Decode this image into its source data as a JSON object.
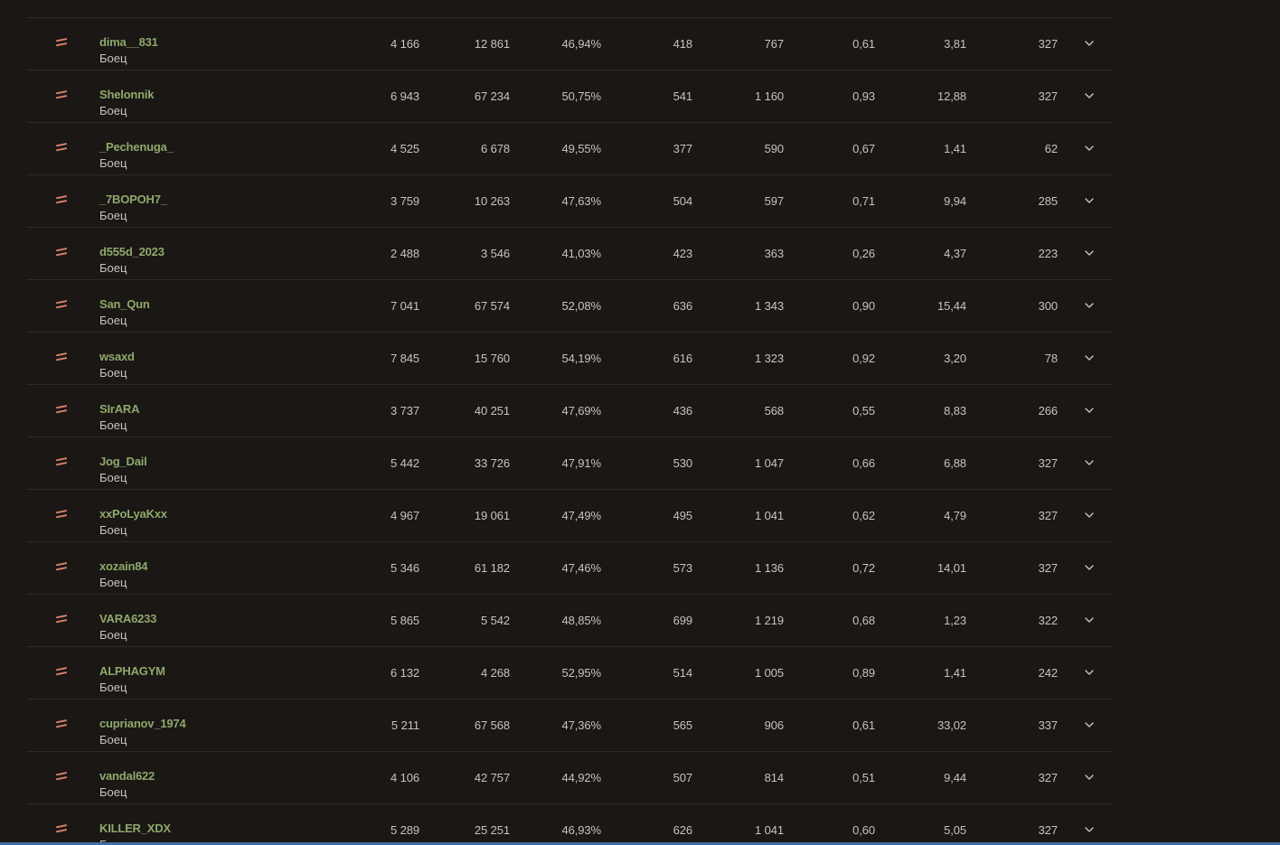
{
  "colors": {
    "background": "#1a1715",
    "name_green": "#8fa86b",
    "text": "#c9c3bd",
    "rank_icon": "#d9826a",
    "divider": "#2e2a27"
  },
  "icons": {
    "rank": "rank-equal-icon",
    "expand": "chevron-down-icon"
  },
  "rows": [
    {
      "name": "",
      "role": "Боец",
      "battles": "",
      "rating": "",
      "wins": "",
      "dmg": "",
      "exp": "",
      "kd": "",
      "spot": "",
      "days": ""
    },
    {
      "name": "dima__831",
      "role": "Боец",
      "battles": "4 166",
      "rating": "12 861",
      "wins": "46,94%",
      "dmg": "418",
      "exp": "767",
      "kd": "0,61",
      "spot": "3,81",
      "days": "327"
    },
    {
      "name": "Shelonnik",
      "role": "Боец",
      "battles": "6 943",
      "rating": "67 234",
      "wins": "50,75%",
      "dmg": "541",
      "exp": "1 160",
      "kd": "0,93",
      "spot": "12,88",
      "days": "327"
    },
    {
      "name": "_Pechenuga_",
      "role": "Боец",
      "battles": "4 525",
      "rating": "6 678",
      "wins": "49,55%",
      "dmg": "377",
      "exp": "590",
      "kd": "0,67",
      "spot": "1,41",
      "days": "62"
    },
    {
      "name": "_7BOPOH7_",
      "role": "Боец",
      "battles": "3 759",
      "rating": "10 263",
      "wins": "47,63%",
      "dmg": "504",
      "exp": "597",
      "kd": "0,71",
      "spot": "9,94",
      "days": "285"
    },
    {
      "name": "d555d_2023",
      "role": "Боец",
      "battles": "2 488",
      "rating": "3 546",
      "wins": "41,03%",
      "dmg": "423",
      "exp": "363",
      "kd": "0,26",
      "spot": "4,37",
      "days": "223"
    },
    {
      "name": "San_Qun",
      "role": "Боец",
      "battles": "7 041",
      "rating": "67 574",
      "wins": "52,08%",
      "dmg": "636",
      "exp": "1 343",
      "kd": "0,90",
      "spot": "15,44",
      "days": "300"
    },
    {
      "name": "wsaxd",
      "role": "Боец",
      "battles": "7 845",
      "rating": "15 760",
      "wins": "54,19%",
      "dmg": "616",
      "exp": "1 323",
      "kd": "0,92",
      "spot": "3,20",
      "days": "78"
    },
    {
      "name": "SIrARA",
      "role": "Боец",
      "battles": "3 737",
      "rating": "40 251",
      "wins": "47,69%",
      "dmg": "436",
      "exp": "568",
      "kd": "0,55",
      "spot": "8,83",
      "days": "266"
    },
    {
      "name": "Jog_Dail",
      "role": "Боец",
      "battles": "5 442",
      "rating": "33 726",
      "wins": "47,91%",
      "dmg": "530",
      "exp": "1 047",
      "kd": "0,66",
      "spot": "6,88",
      "days": "327"
    },
    {
      "name": "xxPoLyaKxx",
      "role": "Боец",
      "battles": "4 967",
      "rating": "19 061",
      "wins": "47,49%",
      "dmg": "495",
      "exp": "1 041",
      "kd": "0,62",
      "spot": "4,79",
      "days": "327"
    },
    {
      "name": "xozain84",
      "role": "Боец",
      "battles": "5 346",
      "rating": "61 182",
      "wins": "47,46%",
      "dmg": "573",
      "exp": "1 136",
      "kd": "0,72",
      "spot": "14,01",
      "days": "327"
    },
    {
      "name": "VARA6233",
      "role": "Боец",
      "battles": "5 865",
      "rating": "5 542",
      "wins": "48,85%",
      "dmg": "699",
      "exp": "1 219",
      "kd": "0,68",
      "spot": "1,23",
      "days": "322"
    },
    {
      "name": "ALPHAGYM",
      "role": "Боец",
      "battles": "6 132",
      "rating": "4 268",
      "wins": "52,95%",
      "dmg": "514",
      "exp": "1 005",
      "kd": "0,89",
      "spot": "1,41",
      "days": "242"
    },
    {
      "name": "cuprianov_1974",
      "role": "Боец",
      "battles": "5 211",
      "rating": "67 568",
      "wins": "47,36%",
      "dmg": "565",
      "exp": "906",
      "kd": "0,61",
      "spot": "33,02",
      "days": "337"
    },
    {
      "name": "vandal622",
      "role": "Боец",
      "battles": "4 106",
      "rating": "42 757",
      "wins": "44,92%",
      "dmg": "507",
      "exp": "814",
      "kd": "0,51",
      "spot": "9,44",
      "days": "327"
    },
    {
      "name": "KILLER_XDX",
      "role": "Боец",
      "battles": "5 289",
      "rating": "25 251",
      "wins": "46,93%",
      "dmg": "626",
      "exp": "1 041",
      "kd": "0,60",
      "spot": "5,05",
      "days": "327"
    }
  ]
}
